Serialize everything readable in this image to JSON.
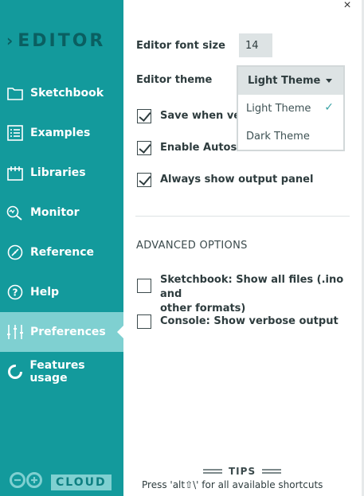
{
  "sidebar": {
    "brand": {
      "chevron": "›",
      "title": "EDITOR"
    },
    "items": [
      {
        "label": "Sketchbook",
        "icon": "folder-icon"
      },
      {
        "label": "Examples",
        "icon": "list-icon"
      },
      {
        "label": "Libraries",
        "icon": "library-icon"
      },
      {
        "label": "Monitor",
        "icon": "monitor-icon"
      },
      {
        "label": "Reference",
        "icon": "compass-icon"
      },
      {
        "label": "Help",
        "icon": "help-icon"
      },
      {
        "label": "Preferences",
        "icon": "sliders-icon",
        "active": true
      },
      {
        "label": "Features usage",
        "icon": "pie-icon"
      }
    ],
    "cloud_label": "CLOUD"
  },
  "close_glyph": "×",
  "prefs": {
    "font_size_label": "Editor font size",
    "font_size_value": "14",
    "theme_label": "Editor theme",
    "theme_selected": "Light Theme",
    "theme_options": [
      "Light Theme",
      "Dark Theme"
    ],
    "save_on_verify_label": "Save when verif",
    "save_on_verify_checked": true,
    "autosave_label": "Enable Autosave",
    "autosave_checked": true,
    "output_panel_label": "Always show output panel",
    "output_panel_checked": true,
    "advanced_title": "ADVANCED OPTIONS",
    "show_all_files_label_1": "Sketchbook: Show all files (.ino and",
    "show_all_files_label_2": "other formats)",
    "show_all_files_checked": false,
    "verbose_label": "Console: Show verbose output",
    "verbose_checked": false
  },
  "tips": {
    "title": "TIPS",
    "shortcut_text": "Press 'alt⇧\\' for all available shortcuts"
  },
  "colors": {
    "sidebar_bg": "#139a9c",
    "active_bg": "#7fd0d1",
    "brand_text": "#0a5f61"
  }
}
